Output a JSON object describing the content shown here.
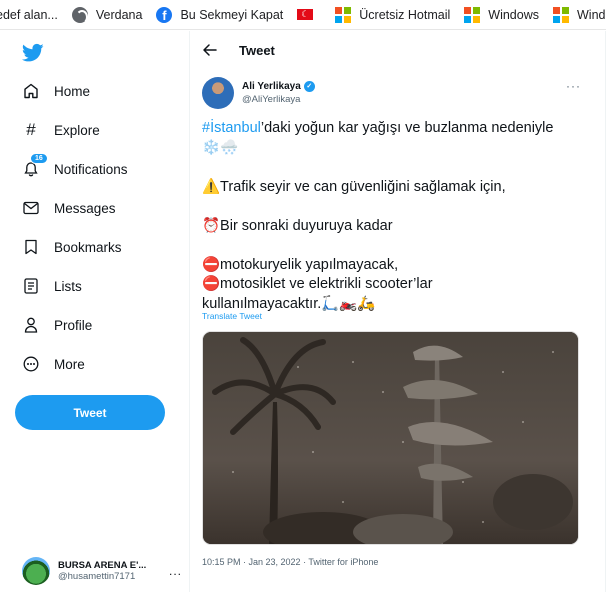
{
  "bookmarks": [
    {
      "label": "edef alan...",
      "icon": "none"
    },
    {
      "label": "Verdana",
      "icon": "globe-icon"
    },
    {
      "label": "Bu Sekmeyi Kapat",
      "icon": "facebook-icon"
    },
    {
      "label": "",
      "icon": "turkish-flag-icon"
    },
    {
      "label": "Ücretsiz Hotmail",
      "icon": "windows-icon"
    },
    {
      "label": "Windows",
      "icon": "windows-icon"
    },
    {
      "label": "Window",
      "icon": "windows-icon"
    }
  ],
  "sidebar": {
    "logo": "twitter-logo",
    "nav": [
      {
        "label": "Home",
        "icon": "home-icon"
      },
      {
        "label": "Explore",
        "icon": "hashtag-icon"
      },
      {
        "label": "Notifications",
        "icon": "bell-icon",
        "badge": "16"
      },
      {
        "label": "Messages",
        "icon": "envelope-icon"
      },
      {
        "label": "Bookmarks",
        "icon": "bookmark-icon"
      },
      {
        "label": "Lists",
        "icon": "list-icon"
      },
      {
        "label": "Profile",
        "icon": "person-icon"
      },
      {
        "label": "More",
        "icon": "more-circle-icon"
      }
    ],
    "tweet_button": "Tweet",
    "account": {
      "name": "BURSA ARENA E'...",
      "handle": "@husamettin7171",
      "more": "..."
    }
  },
  "main": {
    "header_title": "Tweet",
    "tweet": {
      "author_name": "Ali Yerlikaya",
      "author_handle": "@AliYerlikaya",
      "hashtag": "#İstanbul",
      "line1_rest": "’daki yoğun kar yağışı ve buzlanma nedeniyle",
      "line2": "❄️🌨️",
      "line3": "⚠️Trafik seyir ve can güvenliğini sağlamak için,",
      "line4": "⏰Bir sonraki duyuruya kadar",
      "line5": "⛔motokuryelik yapılmayacak,",
      "line6": "⛔motosiklet ve elektrikli scooter’lar",
      "line7": "kullanılmayacaktır.🛴🏍️🛵",
      "translate": "Translate Tweet",
      "meta": "10:15 PM · Jan 23, 2022 · Twitter for iPhone"
    }
  },
  "colors": {
    "accent": "#1d9bf0",
    "text": "#0f1419",
    "secondary": "#536471"
  }
}
